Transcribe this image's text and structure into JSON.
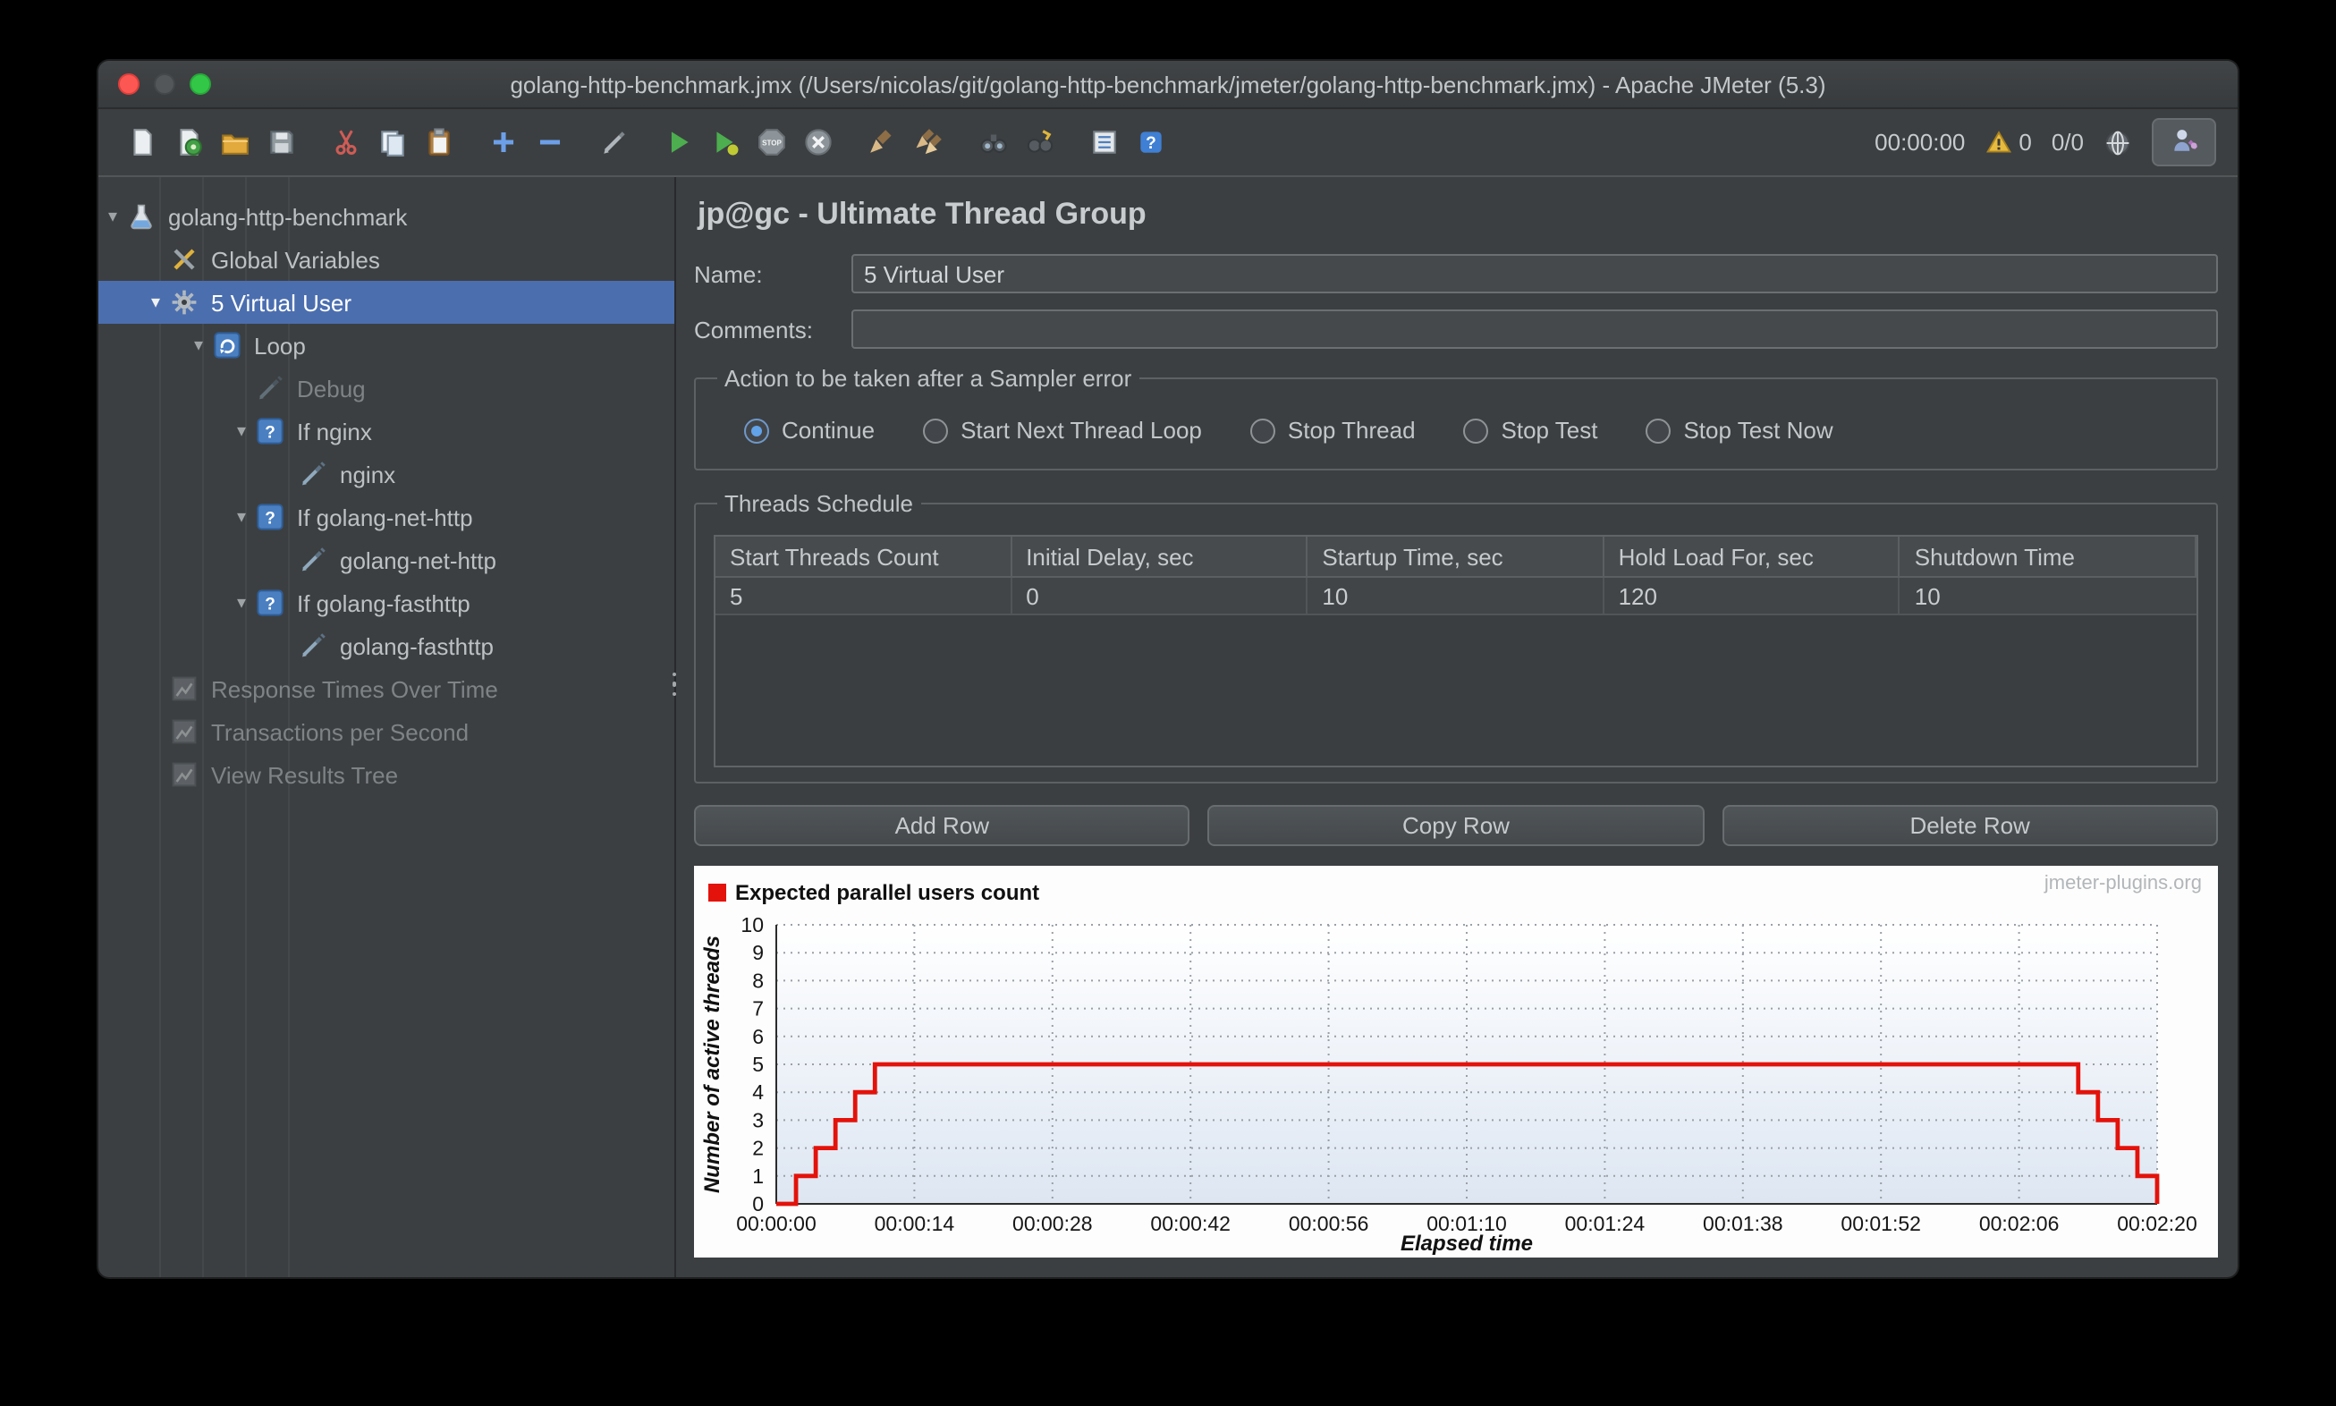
{
  "window": {
    "title": "golang-http-benchmark.jmx (/Users/nicolas/git/golang-http-benchmark/jmeter/golang-http-benchmark.jmx) - Apache JMeter (5.3)"
  },
  "toolbar": {
    "items": [
      {
        "name": "new-file"
      },
      {
        "name": "templates"
      },
      {
        "name": "open-file"
      },
      {
        "name": "save"
      },
      {
        "type": "sep"
      },
      {
        "name": "cut"
      },
      {
        "name": "copy"
      },
      {
        "name": "paste"
      },
      {
        "type": "sep"
      },
      {
        "name": "plus"
      },
      {
        "name": "minus"
      },
      {
        "type": "sep"
      },
      {
        "name": "toggle"
      },
      {
        "type": "sep"
      },
      {
        "name": "start"
      },
      {
        "name": "start-no-timers"
      },
      {
        "name": "stop"
      },
      {
        "name": "shutdown"
      },
      {
        "type": "sep"
      },
      {
        "name": "clean"
      },
      {
        "name": "clean-all"
      },
      {
        "type": "sep"
      },
      {
        "name": "search"
      },
      {
        "name": "search-reset"
      },
      {
        "type": "sep"
      },
      {
        "name": "function-helper"
      },
      {
        "name": "help"
      }
    ],
    "timer": "00:00:00",
    "warning_count": "0",
    "thread_counts": "0/0"
  },
  "tree": {
    "items": [
      {
        "label": "golang-http-benchmark",
        "level": 0,
        "icon": "flask",
        "expanded": true
      },
      {
        "label": "Global Variables",
        "level": 1,
        "icon": "tools"
      },
      {
        "label": "5 Virtual User",
        "level": 1,
        "icon": "gear",
        "expanded": true,
        "selected": true
      },
      {
        "label": "Loop",
        "level": 2,
        "icon": "loop",
        "expanded": true
      },
      {
        "label": "Debug",
        "level": 3,
        "icon": "probe",
        "disabled": true
      },
      {
        "label": "If nginx",
        "level": 3,
        "icon": "if",
        "expanded": true
      },
      {
        "label": "nginx",
        "level": 4,
        "icon": "probe"
      },
      {
        "label": "If golang-net-http",
        "level": 3,
        "icon": "if",
        "expanded": true
      },
      {
        "label": "golang-net-http",
        "level": 4,
        "icon": "probe"
      },
      {
        "label": "If golang-fasthttp",
        "level": 3,
        "icon": "if",
        "expanded": true
      },
      {
        "label": "golang-fasthttp",
        "level": 4,
        "icon": "probe"
      },
      {
        "label": "Response Times Over Time",
        "level": 1,
        "icon": "chart",
        "disabled": true
      },
      {
        "label": "Transactions per Second",
        "level": 1,
        "icon": "chart",
        "disabled": true
      },
      {
        "label": "View Results Tree",
        "level": 1,
        "icon": "chart",
        "disabled": true
      }
    ]
  },
  "main": {
    "title": "jp@gc - Ultimate Thread Group",
    "name_label": "Name:",
    "name_value": "5 Virtual User",
    "comments_label": "Comments:",
    "comments_value": "",
    "sampler_error": {
      "title": "Action to be taken after a Sampler error",
      "options": [
        {
          "label": "Continue",
          "selected": true
        },
        {
          "label": "Start Next Thread Loop",
          "selected": false
        },
        {
          "label": "Stop Thread",
          "selected": false
        },
        {
          "label": "Stop Test",
          "selected": false
        },
        {
          "label": "Stop Test Now",
          "selected": false
        }
      ]
    },
    "threads_schedule": {
      "title": "Threads Schedule",
      "columns": [
        "Start Threads Count",
        "Initial Delay, sec",
        "Startup Time, sec",
        "Hold Load For, sec",
        "Shutdown Time"
      ],
      "rows": [
        [
          "5",
          "0",
          "10",
          "120",
          "10"
        ]
      ]
    },
    "buttons": [
      "Add Row",
      "Copy Row",
      "Delete Row"
    ]
  },
  "chart_data": {
    "type": "line",
    "legend": "Expected parallel users count",
    "watermark": "jmeter-plugins.org",
    "xlabel": "Elapsed time",
    "ylabel": "Number of active threads",
    "xlim": [
      0,
      140
    ],
    "ylim": [
      0,
      10
    ],
    "y_ticks": [
      0,
      1,
      2,
      3,
      4,
      5,
      6,
      7,
      8,
      9,
      10
    ],
    "x_tick_labels": [
      "00:00:00",
      "00:00:14",
      "00:00:28",
      "00:00:42",
      "00:00:56",
      "00:01:10",
      "00:01:24",
      "00:01:38",
      "00:01:52",
      "00:02:06",
      "00:02:20"
    ],
    "x_tick_seconds": [
      0,
      14,
      28,
      42,
      56,
      70,
      84,
      98,
      112,
      126,
      140
    ],
    "grid": true,
    "legend_position": "top-left",
    "series": [
      {
        "name": "Expected parallel users count",
        "color": "#e3120b",
        "step": true,
        "points": [
          [
            0,
            0
          ],
          [
            2,
            1
          ],
          [
            4,
            2
          ],
          [
            6,
            3
          ],
          [
            8,
            4
          ],
          [
            10,
            5
          ],
          [
            130,
            5
          ],
          [
            132,
            4
          ],
          [
            134,
            3
          ],
          [
            136,
            2
          ],
          [
            138,
            1
          ],
          [
            140,
            0
          ]
        ]
      }
    ]
  }
}
